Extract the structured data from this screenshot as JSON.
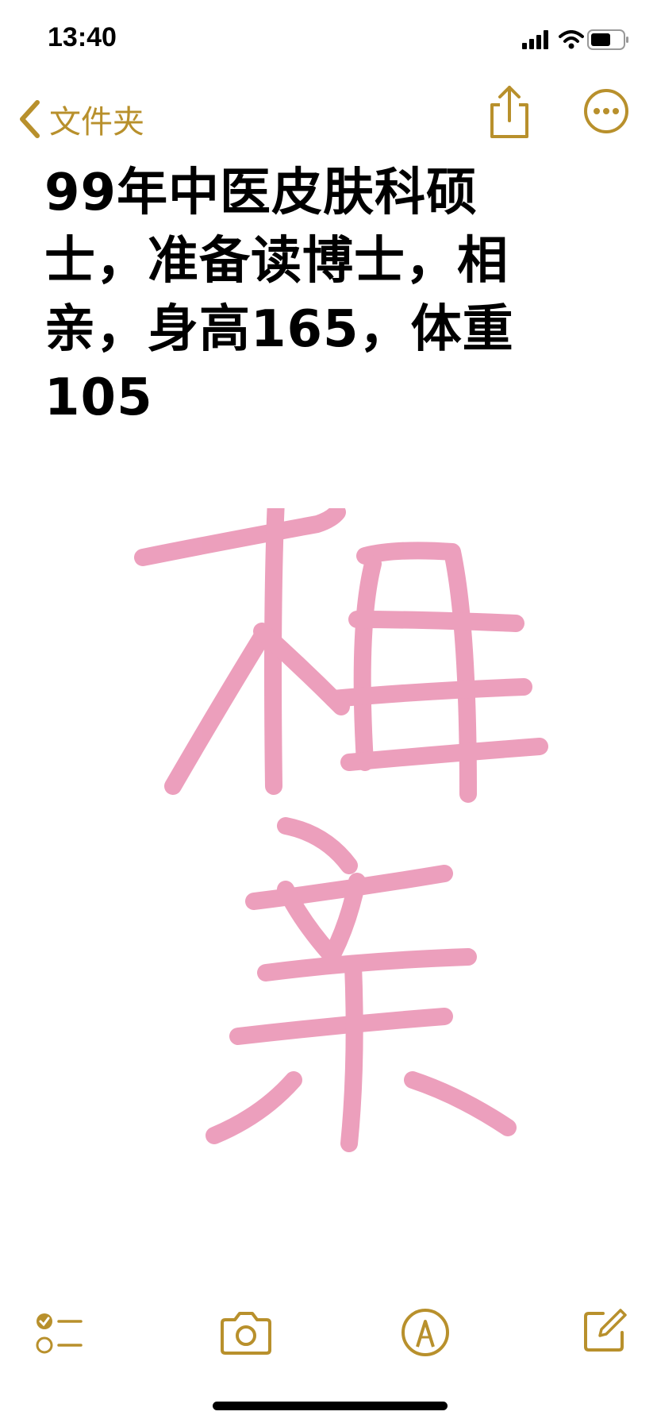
{
  "status_bar": {
    "time": "13:40"
  },
  "nav": {
    "back_label": "文件夹"
  },
  "note": {
    "title_lines": [
      "99年中医皮肤科硕",
      "士，准备读博士，相",
      "亲，身高165，体重",
      "105"
    ]
  },
  "drawing": {
    "stroke_color": "#e88aae",
    "icon_color": "#b8902c"
  },
  "icons": [
    "chevron-left-icon",
    "share-icon",
    "more-icon",
    "checklist-icon",
    "camera-icon",
    "markup-icon",
    "compose-icon"
  ]
}
